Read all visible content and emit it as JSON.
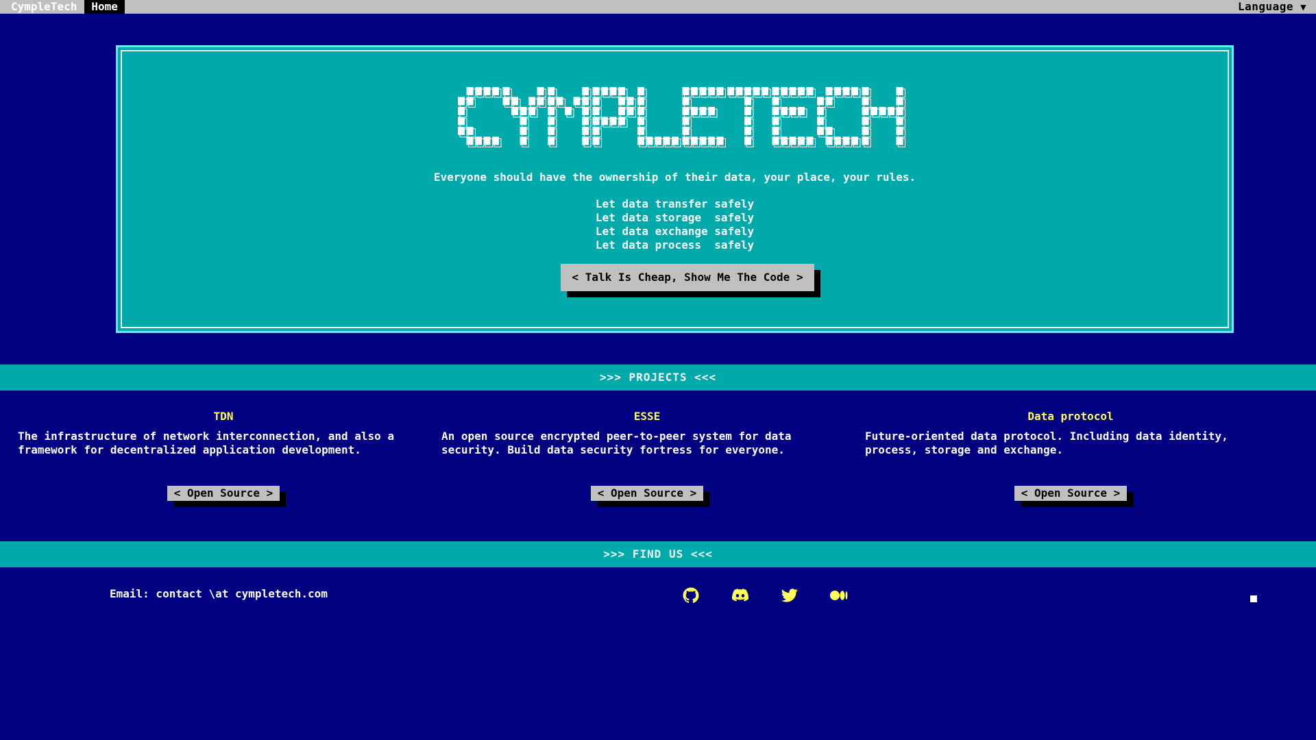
{
  "menubar": {
    "brand": "CympleTech",
    "home": "Home",
    "language": "Language",
    "caret": "▼"
  },
  "hero": {
    "logo_text": "CYMPLETECH",
    "tagline": "Everyone should have the ownership of their data, your place, your rules.",
    "lines": [
      "Let data transfer safely",
      "Let data storage  safely",
      "Let data exchange safely",
      "Let data process  safely"
    ],
    "cta_label": "< Talk Is Cheap, Show Me The Code >"
  },
  "projects": {
    "heading": ">>> PROJECTS <<<",
    "items": [
      {
        "title": "TDN",
        "description": "The infrastructure of network interconnection, and also a framework for decentralized application development.",
        "button": "< Open Source >"
      },
      {
        "title": "ESSE",
        "description": "An open source encrypted peer-to-peer system for data security. Build data security fortress for everyone.",
        "button": "< Open Source >"
      },
      {
        "title": "Data protocol",
        "description": "Future-oriented data protocol. Including data identity, process, storage and exchange.",
        "button": "< Open Source >"
      }
    ]
  },
  "find_us": {
    "heading": ">>> FIND US <<<",
    "email": "Email: contact \\at cympletech.com",
    "icons": [
      "github-icon",
      "discord-icon",
      "twitter-icon",
      "medium-icon"
    ]
  },
  "colors": {
    "background": "#000080",
    "panel": "#00aaaa",
    "menubar": "#c0c0c0",
    "title_yellow": "#ffff55",
    "icon_yellow": "#ffff55"
  }
}
